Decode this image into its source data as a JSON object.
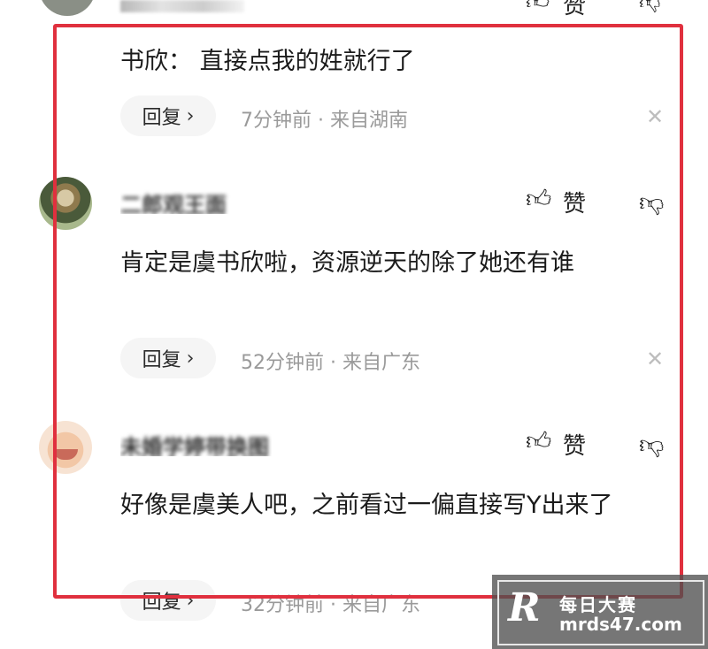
{
  "top_row": {
    "like_label": "赞",
    "icons": {
      "like": "thumbs-up-icon",
      "dislike": "thumbs-down-icon"
    }
  },
  "comments": [
    {
      "text": "书欣：  直接点我的姓就行了",
      "reply_label": "回复",
      "meta": "7分钟前 · 来自湖南"
    },
    {
      "author": "二郎观王面",
      "like_label": "赞",
      "text": "肯定是虞书欣啦，资源逆天的除了她还有谁",
      "reply_label": "回复",
      "meta": "52分钟前 · 来自广东"
    },
    {
      "author": "未婚学婷带换图",
      "like_label": "赞",
      "text": "好像是虞美人吧，之前看过一偏直接写Y出来了",
      "reply_label": "回复",
      "meta": "32分钟前 · 来自广东"
    }
  ],
  "icons": {
    "like": "thumbs-up-icon",
    "dislike": "thumbs-down-icon",
    "close": "close-icon",
    "chevron": "chevron-right-icon"
  },
  "colors": {
    "highlight_frame": "#e0303e",
    "meta_text": "#9a9a9a",
    "pill_bg": "#f5f5f5"
  },
  "watermark": {
    "logo": "R",
    "title": "每日大赛",
    "url": "mrds47.com"
  }
}
